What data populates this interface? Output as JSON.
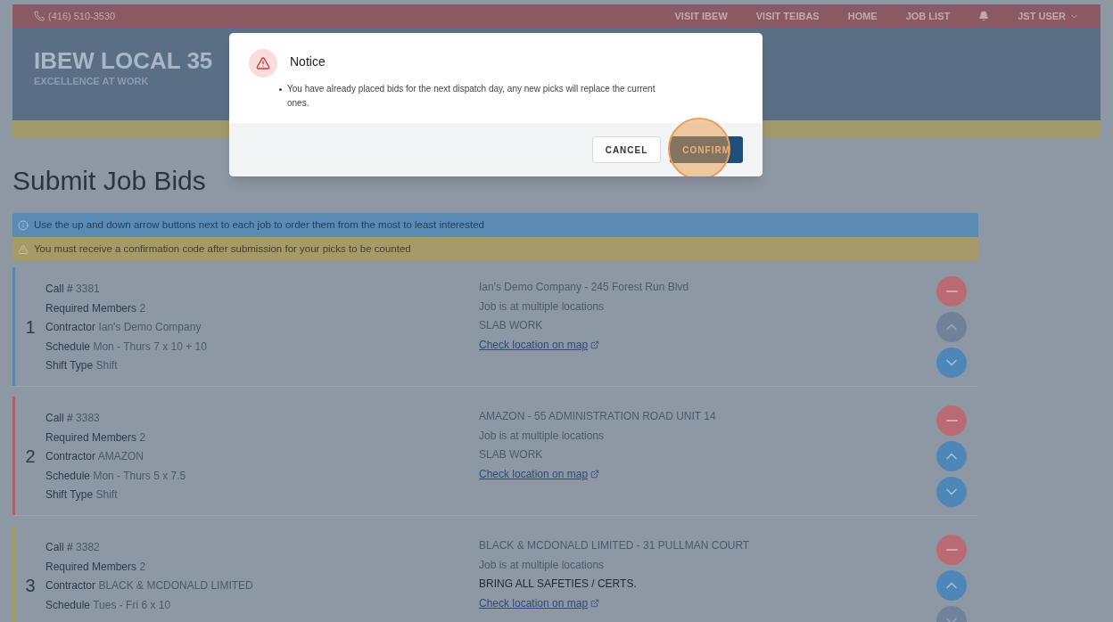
{
  "top_bar": {
    "phone": "(416) 510-3530",
    "nav": [
      {
        "label": "VISIT IBEW",
        "kind": "link"
      },
      {
        "label": "VISIT TEIBAS",
        "kind": "link"
      },
      {
        "label": "HOME",
        "kind": "link"
      },
      {
        "label": "JOB LIST",
        "kind": "link"
      },
      {
        "kind": "bell"
      },
      {
        "label": "JST USER",
        "kind": "user"
      }
    ]
  },
  "header": {
    "title": "IBEW LOCAL 35",
    "subtitle": "EXCELLENCE AT WORK"
  },
  "page_title": "Submit Job Bids",
  "alerts": [
    {
      "kind": "info",
      "text": "Use the up and down arrow buttons next to each job to order them from the most to least interested"
    },
    {
      "kind": "warning",
      "text": "You must receive a confirmation code after submission for your picks to be counted"
    }
  ],
  "jobs": [
    {
      "rank": "1",
      "color": "#5a86b0",
      "fields": [
        {
          "label": "Call #",
          "value": "3381"
        },
        {
          "label": "Required Members",
          "value": "2"
        },
        {
          "label": "Contractor",
          "value": "Ian's Demo Company"
        },
        {
          "label": "Schedule",
          "value": "Mon - Thurs 7 x 10 + 10"
        },
        {
          "label": "Shift Type",
          "value": "Shift"
        }
      ],
      "details": [
        {
          "text": "Ian's Demo Company - 245 Forest Run Blvd",
          "emphasis": false
        },
        {
          "text": "Job is at multiple locations",
          "emphasis": false
        },
        {
          "text": "SLAB WORK",
          "emphasis": false
        }
      ],
      "map_link": "Check location on map",
      "up_disabled": true,
      "down_disabled": false
    },
    {
      "rank": "2",
      "color": "#a8626d",
      "fields": [
        {
          "label": "Call #",
          "value": "3383"
        },
        {
          "label": "Required Members",
          "value": "2"
        },
        {
          "label": "Contractor",
          "value": "AMAZON"
        },
        {
          "label": "Schedule",
          "value": "Mon - Thurs 5 x 7.5"
        },
        {
          "label": "Shift Type",
          "value": "Shift"
        }
      ],
      "details": [
        {
          "text": "AMAZON - 55 ADMINISTRATION ROAD UNIT 14",
          "emphasis": false
        },
        {
          "text": "Job is at multiple locations",
          "emphasis": false
        },
        {
          "text": "SLAB WORK",
          "emphasis": false
        }
      ],
      "map_link": "Check location on map",
      "up_disabled": false,
      "down_disabled": false
    },
    {
      "rank": "3",
      "color": "#a39a64",
      "fields": [
        {
          "label": "Call #",
          "value": "3382"
        },
        {
          "label": "Required Members",
          "value": "2"
        },
        {
          "label": "Contractor",
          "value": "BLACK & MCDONALD LIMITED"
        },
        {
          "label": "Schedule",
          "value": "Tues - Fri 6 x 10"
        }
      ],
      "details": [
        {
          "text": "BLACK & MCDONALD LIMITED - 31 PULLMAN COURT",
          "emphasis": false
        },
        {
          "text": "Job is at multiple locations",
          "emphasis": false
        },
        {
          "text": "BRING ALL SAFETIES / CERTS.",
          "emphasis": true
        }
      ],
      "map_link": "Check location on map",
      "up_disabled": false,
      "down_disabled": true
    }
  ],
  "dialog": {
    "title": "Notice",
    "messages": [
      "You have already placed bids for the next dispatch day, any new picks will replace the current ones."
    ],
    "buttons": [
      {
        "label": "CANCEL",
        "kind": "secondary"
      },
      {
        "label": "CONFIRM",
        "kind": "primary",
        "highlighted": true
      }
    ]
  }
}
